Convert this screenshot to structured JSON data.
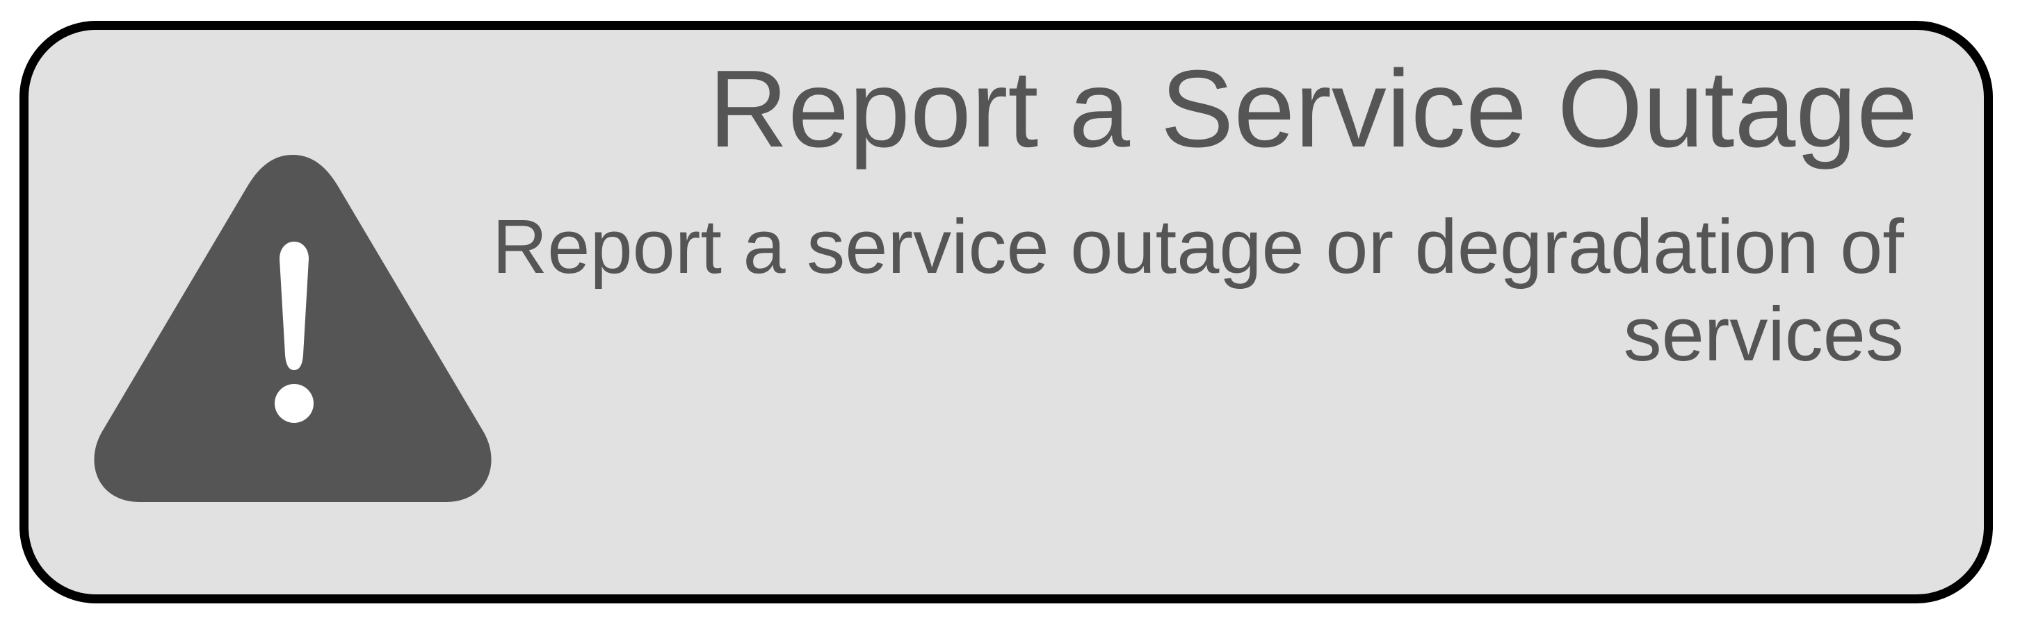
{
  "card": {
    "title": "Report a Service Outage",
    "description": "Report a service outage or degradation of services",
    "icon": "warning-triangle-icon"
  },
  "colors": {
    "background": "#e1e1e1",
    "border": "#000000",
    "foreground": "#555555"
  }
}
